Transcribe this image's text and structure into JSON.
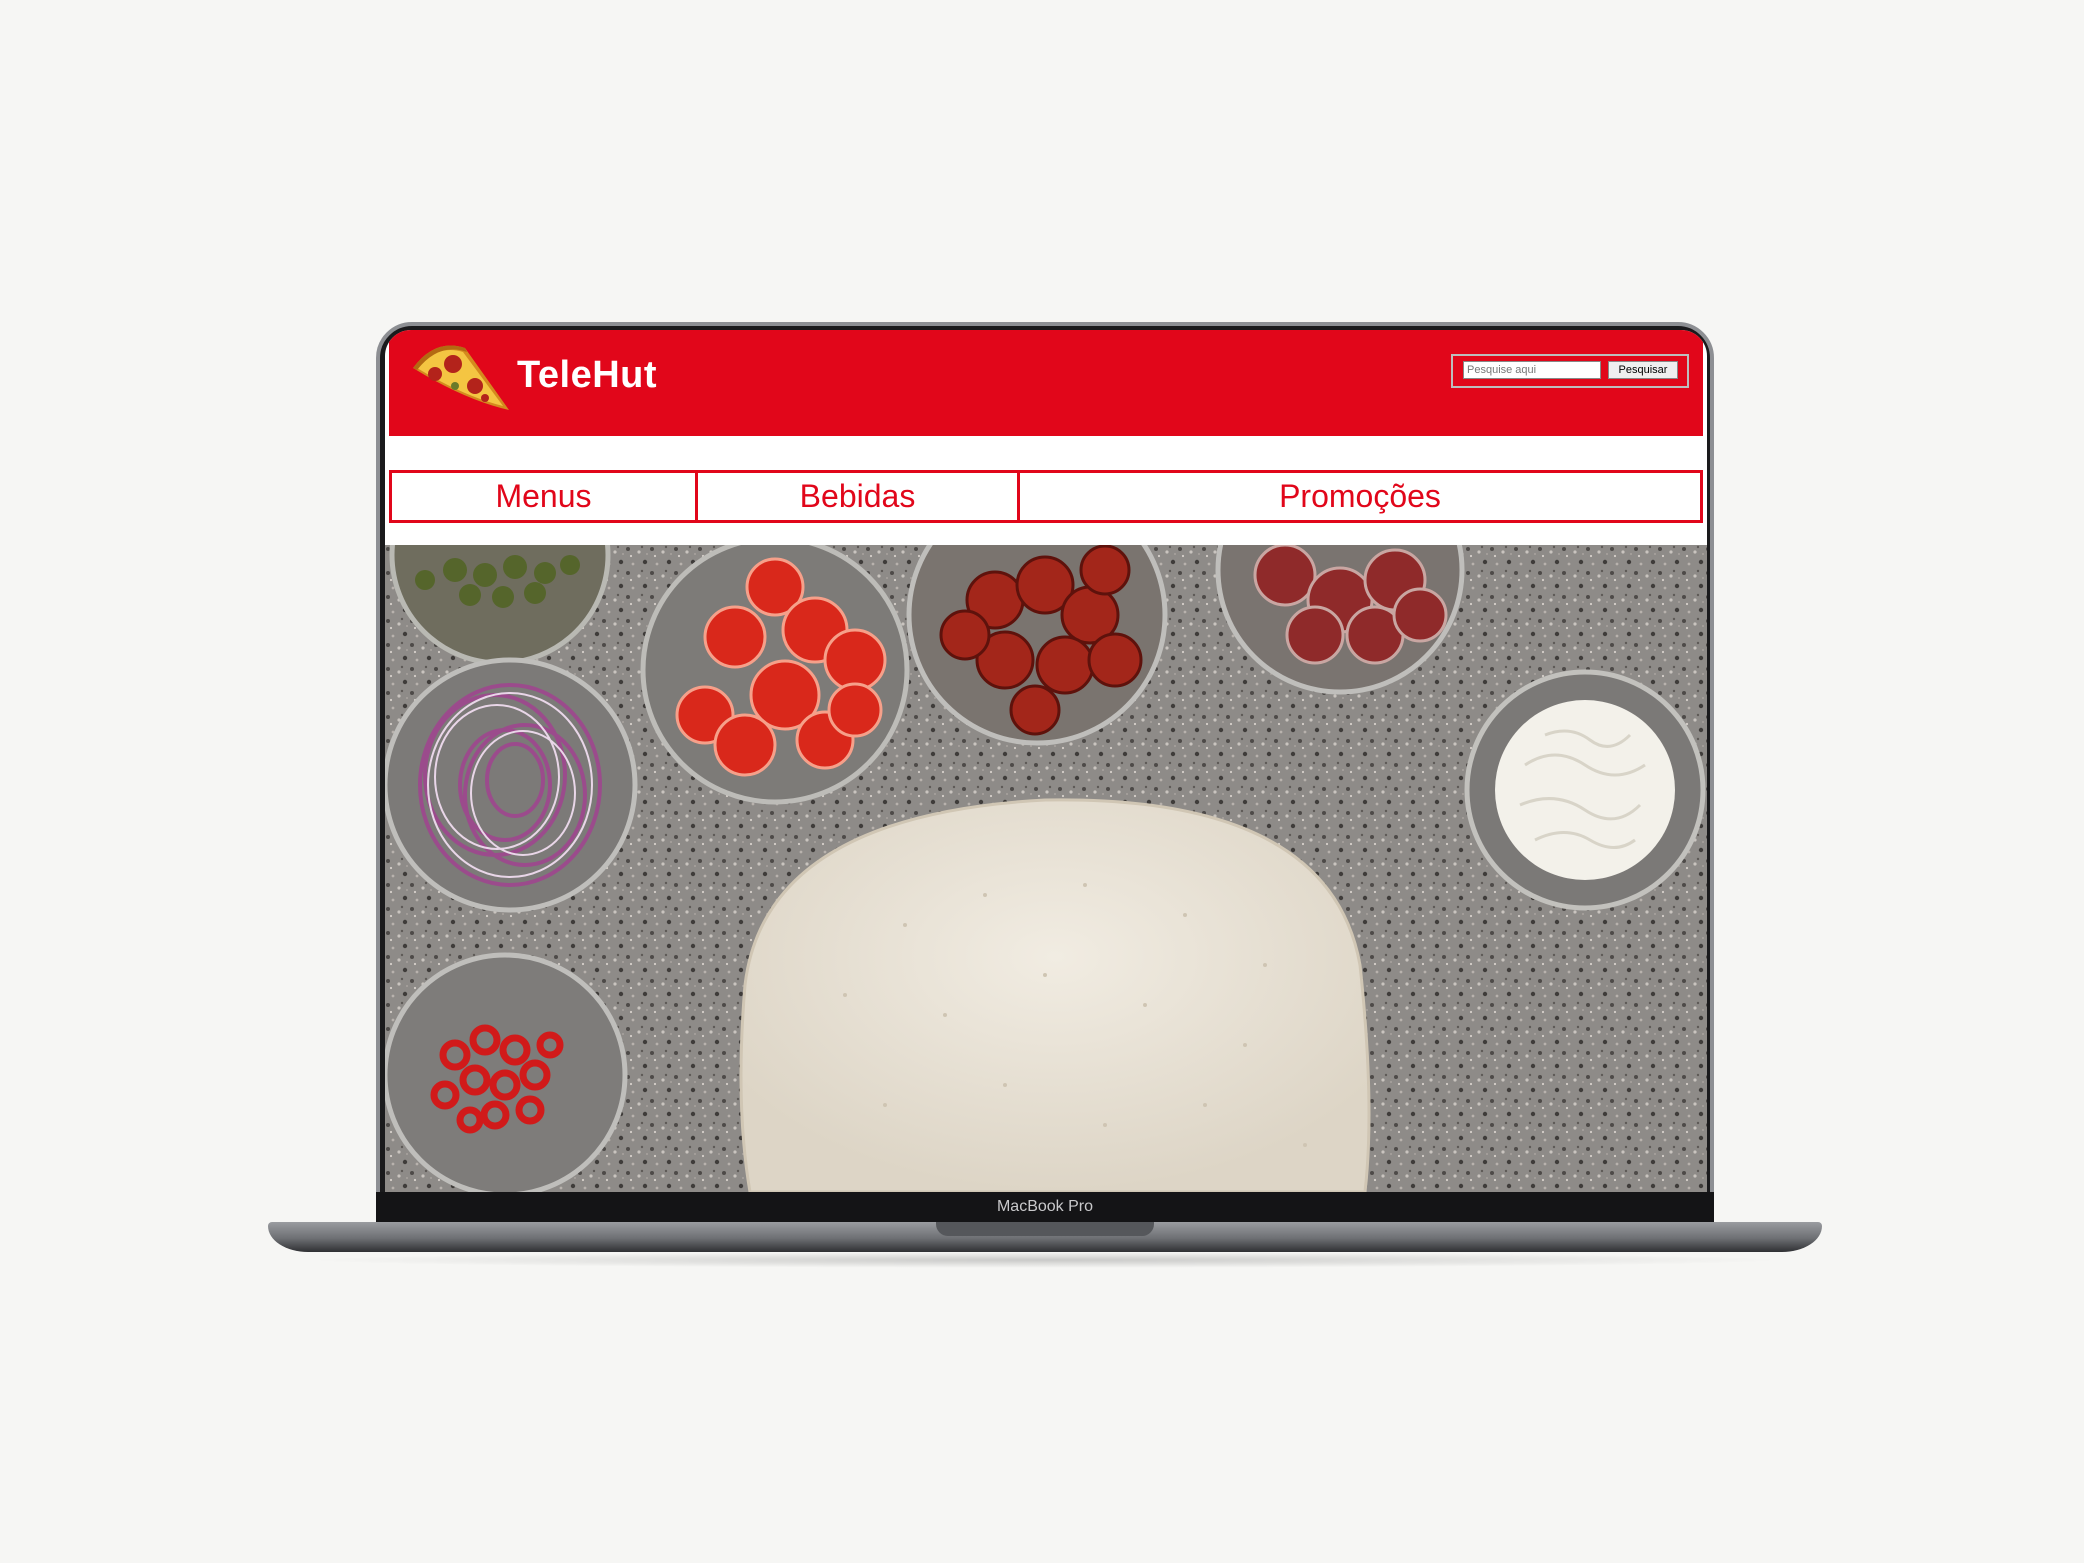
{
  "site": {
    "brand": "TeleHut",
    "logo_icon": "pizza-slice-icon"
  },
  "search": {
    "placeholder": "Pesquise aqui",
    "button_label": "Pesquisar"
  },
  "nav": {
    "items": [
      {
        "label": "Menus"
      },
      {
        "label": "Bebidas"
      },
      {
        "label": "Promoções"
      }
    ]
  },
  "device": {
    "label": "MacBook Pro"
  },
  "colors": {
    "brand_red": "#e1061a",
    "header_text": "#ffffff",
    "page_background": "#f6f6f4"
  }
}
